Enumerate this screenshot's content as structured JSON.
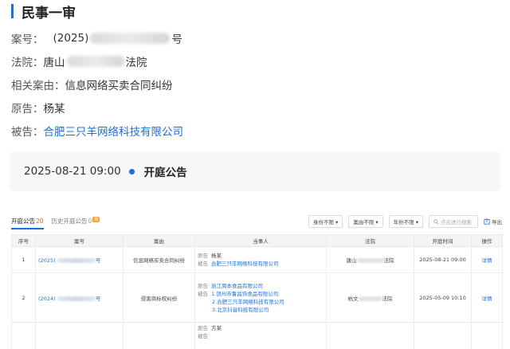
{
  "header": {
    "title": "民事一审"
  },
  "case": {
    "case_no_label": "案号：",
    "case_no_prefix": "(2025)",
    "case_no_suffix": "号",
    "court_label": "法院：",
    "court_prefix": "唐山",
    "court_suffix": "法院",
    "cause_label": "相关案由：",
    "cause_value": "信息网络买卖合同纠纷",
    "plaintiff_label": "原告：",
    "plaintiff_value": "杨某",
    "defendant_label": "被告：",
    "defendant_value": "合肥三只羊网络科技有限公司"
  },
  "hearing": {
    "time": "2025-08-21 09:00",
    "type": "开庭公告"
  },
  "table": {
    "tabs": [
      {
        "label": "开庭公告",
        "count": "20"
      },
      {
        "label": "历史开庭公告",
        "count": "0",
        "badge": "新"
      }
    ],
    "filters": [
      "身份不限",
      "案由不限",
      "年份不限"
    ],
    "search_placeholder": "点击进行搜索",
    "export_label": "导出",
    "columns": [
      "序号",
      "案号",
      "案由",
      "当事人",
      "法院",
      "开庭时间",
      "操作"
    ],
    "rows": [
      {
        "index": "1",
        "case_prefix": "(2025)",
        "case_suffix": "号",
        "cause": "信息网络买卖合同纠纷",
        "parties": [
          {
            "role": "原告",
            "name": "杨某"
          },
          {
            "role": "被告",
            "name": "合肥三只羊网络科技有限公司"
          }
        ],
        "court_prefix": "唐山",
        "court_suffix": "法院",
        "time": "2025-08-21 09:00",
        "action": "详情"
      },
      {
        "index": "2",
        "case_prefix": "(2024)",
        "case_suffix": "号",
        "cause": "侵害商标权纠纷",
        "parties": [
          {
            "role": "原告",
            "name": "浙江周本食品有限公司"
          },
          {
            "role": "被告",
            "name": "1.饶州市鲁昌饰食品有限公司"
          },
          {
            "role": "",
            "name": "2.合肥三只羊网络科技有限公司"
          },
          {
            "role": "",
            "name": "3.北京抖音科技有限公司"
          }
        ],
        "court_prefix": "杭文",
        "court_suffix": "法院",
        "time": "2025-05-09 10:10",
        "action": "详情"
      },
      {
        "index": "",
        "case_prefix": "",
        "case_suffix": "",
        "cause": "",
        "parties": [
          {
            "role": "原告",
            "name": "方某"
          },
          {
            "role": "被告",
            "name": ""
          }
        ],
        "court_prefix": "",
        "court_suffix": "",
        "time": "",
        "action": ""
      }
    ]
  },
  "colors": {
    "accent": "#1d6fe0",
    "count": "#e0612b"
  }
}
